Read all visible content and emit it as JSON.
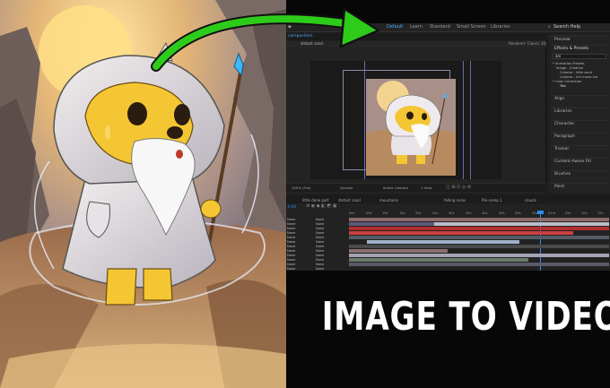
{
  "headline": "IMAGE TO VIDEO",
  "workspace_tabs": [
    "Default",
    "Learn",
    "Standard",
    "Small Screen",
    "Libraries"
  ],
  "search_help": "Search Help",
  "comp_tab": "composition",
  "comp_breadcrumb": "distant sand",
  "renderer": "Renderer: Classic 3D",
  "viewer_footer": {
    "zoom": "100% (Full)",
    "quality": "Quarter",
    "camera": "Active Camera",
    "views": "1 View"
  },
  "right_panel": {
    "preview": "Preview",
    "effects": "Effects & Presets",
    "search_value": "ani",
    "tree": [
      "* Animation Presets",
      "Image - Creative",
      "Colorize - little sand",
      "Colorize - ntn mono-clo",
      "* Color Correction",
      "Tint"
    ],
    "panels": [
      "Align",
      "Libraries",
      "Character",
      "Paragraph",
      "Tracker",
      "Content-Aware Fill",
      "Brushes",
      "Paint"
    ]
  },
  "timeline_tabs": [
    "little done part",
    "distant sand",
    "mountains",
    "falling rocks",
    "Pre-comp 1",
    "clouds"
  ],
  "timecode": "0:00",
  "ruler": [
    "00s",
    "05s",
    "10s",
    "15s",
    "20s",
    "25s",
    "30s",
    "35s",
    "40s",
    "45s",
    "50s",
    "55s",
    "01m",
    "05s",
    "10s",
    "15s"
  ],
  "layers": [
    {
      "mode": "None",
      "parent": "None"
    },
    {
      "mode": "None",
      "parent": "None"
    },
    {
      "mode": "None",
      "parent": "None"
    },
    {
      "mode": "None",
      "parent": "None"
    },
    {
      "mode": "None",
      "parent": "None"
    },
    {
      "mode": "None",
      "parent": "None"
    },
    {
      "mode": "None",
      "parent": "None"
    },
    {
      "mode": "None",
      "parent": "None"
    },
    {
      "mode": "None",
      "parent": "None"
    },
    {
      "mode": "None",
      "parent": "None"
    },
    {
      "mode": "None",
      "parent": "None"
    },
    {
      "mode": "None",
      "parent": "None"
    }
  ],
  "colors": {
    "arrow": "#2ecc1a",
    "accent": "#2d8ceb",
    "bg": "#000000"
  }
}
